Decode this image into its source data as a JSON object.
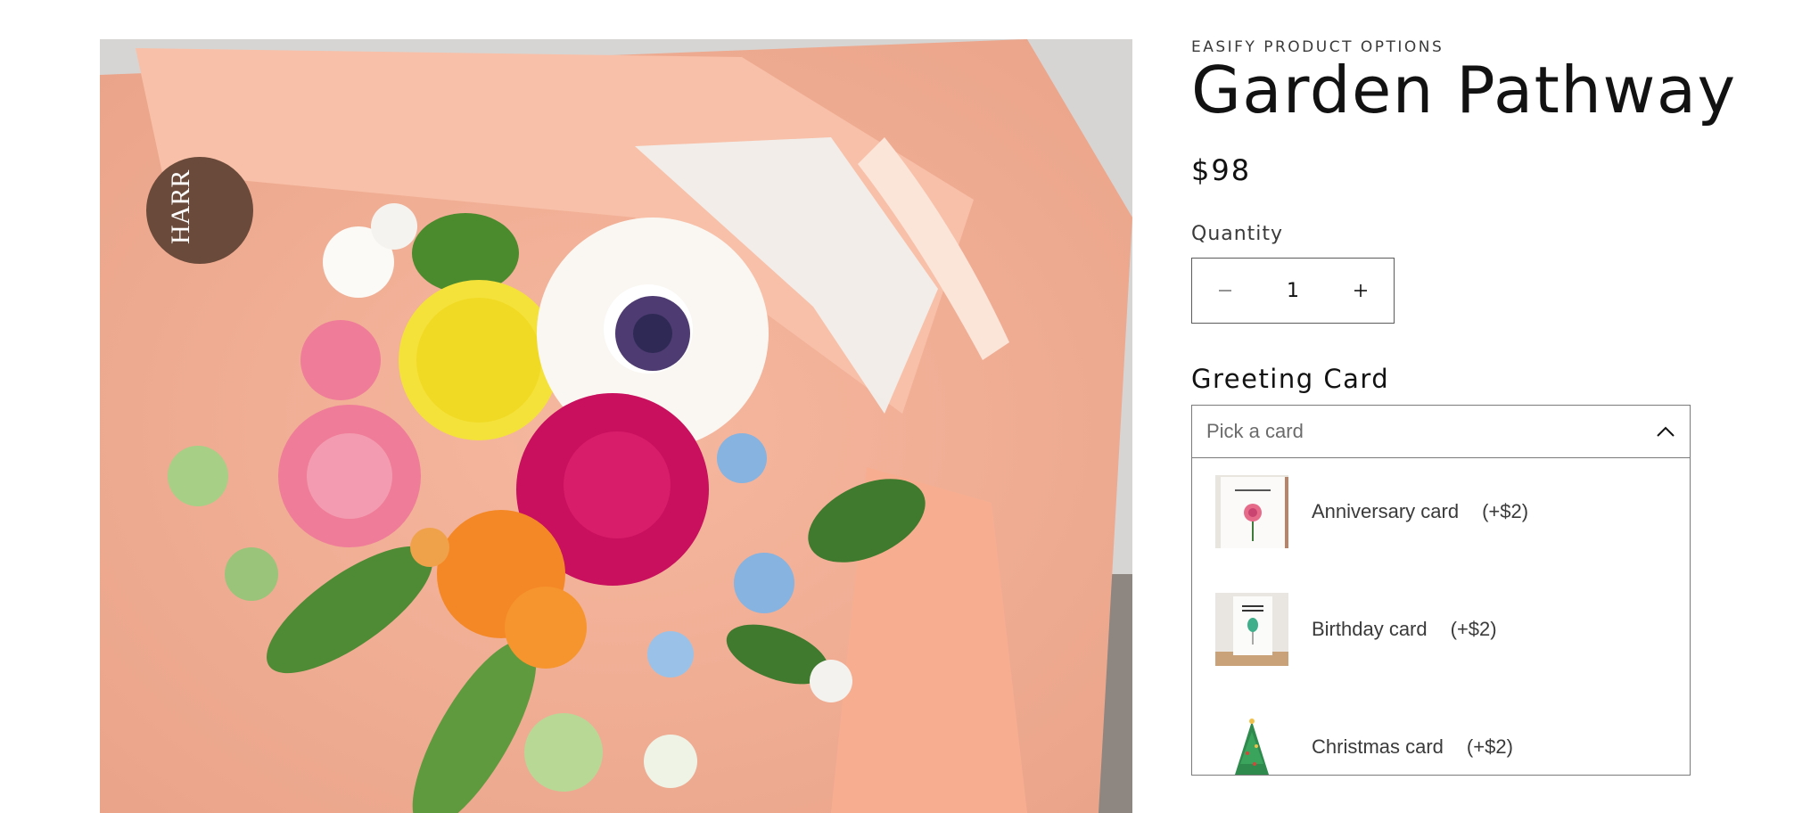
{
  "product": {
    "vendor": "EASIFY PRODUCT OPTIONS",
    "title": "Garden Pathway",
    "price": "$98",
    "image_logo_text": "HARR"
  },
  "quantity": {
    "label": "Quantity",
    "value": "1",
    "decrement_icon": "minus-icon",
    "increment_icon": "plus-icon"
  },
  "greeting_card": {
    "title": "Greeting Card",
    "placeholder": "Pick a card",
    "toggle_icon": "chevron-up-icon",
    "options": [
      {
        "label": "Anniversary card",
        "price": "(+$2)",
        "thumb_icon": "flower-card-icon"
      },
      {
        "label": "Birthday card",
        "price": "(+$2)",
        "thumb_icon": "balloon-card-icon"
      },
      {
        "label": "Christmas card",
        "price": "(+$2)",
        "thumb_icon": "christmas-tree-card-icon"
      }
    ]
  },
  "colors": {
    "text": "#121212",
    "border": "#7a7a7a",
    "wrap_paper": "#f7b49a"
  }
}
